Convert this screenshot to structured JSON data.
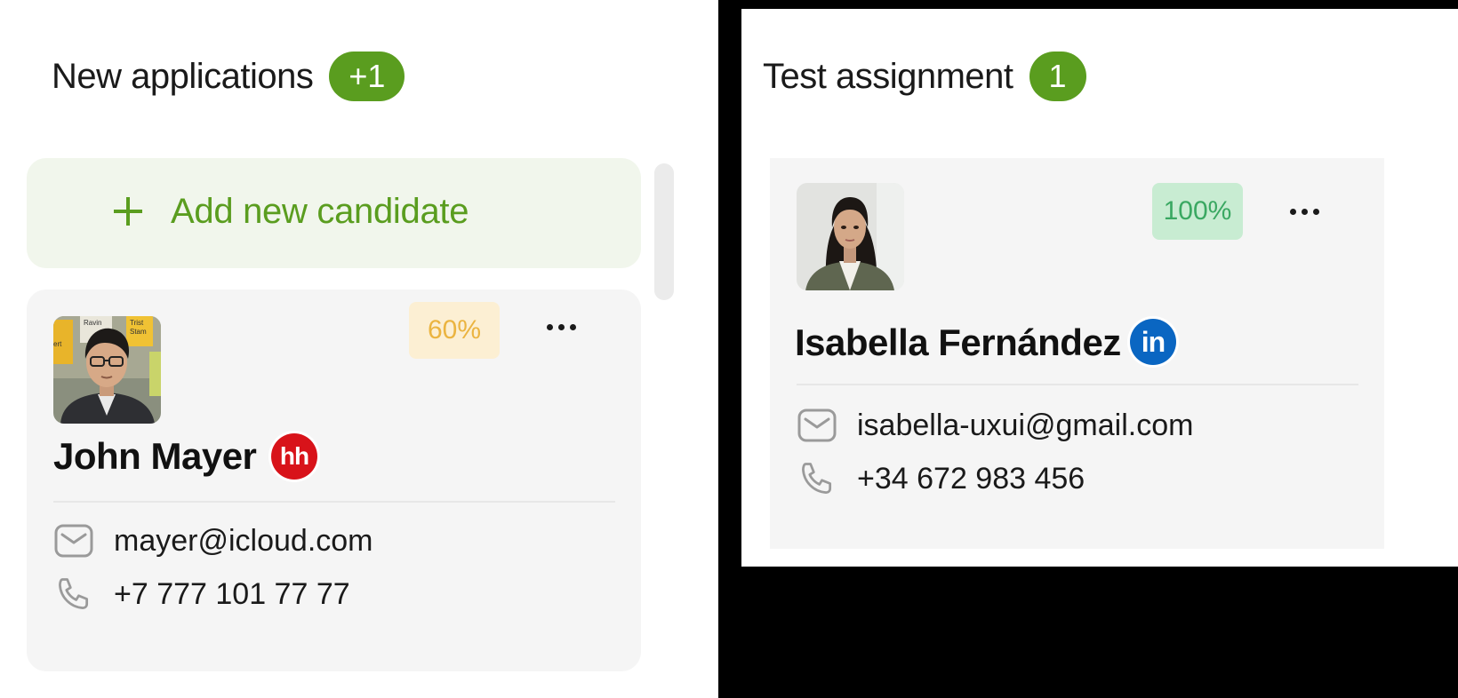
{
  "columns": [
    {
      "title": "New applications",
      "count": "+1",
      "add_label": "Add new candidate",
      "candidate": {
        "name": "John Mayer",
        "score": "60%",
        "source": "hh",
        "email": "mayer@icloud.com",
        "phone": "+7 777 101 77 77",
        "avatar_notes": [
          "Ravin",
          "Trist",
          "Stam",
          "ert"
        ]
      }
    },
    {
      "title": "Test assignment",
      "count": "1",
      "candidate": {
        "name": "Isabella Fernández",
        "score": "100%",
        "source": "in",
        "email": "isabella-uxui@gmail.com",
        "phone": "+34 672 983 456"
      }
    }
  ],
  "icons": {
    "plus": "plus-icon",
    "more": "more-dots-icon",
    "email": "envelope-icon",
    "phone": "phone-icon"
  },
  "colors": {
    "accent_green": "#5a9d1f",
    "add_card_bg": "#f1f6ec",
    "score_medium_bg": "#fcefd3",
    "score_medium_text": "#ebb440",
    "score_high_bg": "#c8ecd2",
    "score_high_text": "#3aa862",
    "hh_red": "#d8131a",
    "linkedin_blue": "#0a66c2"
  }
}
